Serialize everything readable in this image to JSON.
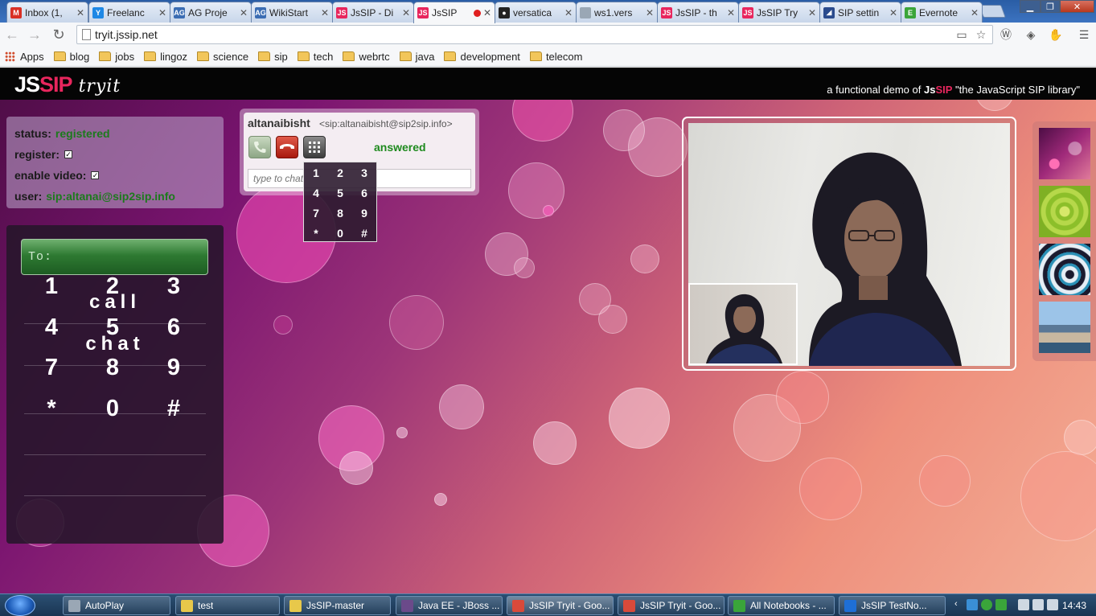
{
  "browser": {
    "tabs": [
      {
        "label": "Inbox (1,",
        "icon": "gmail-icon",
        "color": "#d93025",
        "glyph": "M"
      },
      {
        "label": "Freelanc",
        "icon": "freelancer-icon",
        "color": "#1e88e5",
        "glyph": "Y"
      },
      {
        "label": "AG Proje",
        "icon": "ag-icon",
        "color": "#3b6db3",
        "glyph": "AG"
      },
      {
        "label": "WikiStart",
        "icon": "ag-icon",
        "color": "#3b6db3",
        "glyph": "AG"
      },
      {
        "label": "JsSIP - Di",
        "icon": "jssip-icon",
        "color": "#e8265d",
        "glyph": "JS"
      },
      {
        "label": "JsSIP",
        "icon": "jssip-icon",
        "color": "#e8265d",
        "glyph": "JS",
        "active": true
      },
      {
        "label": "versatica",
        "icon": "github-icon",
        "color": "#222222",
        "glyph": "●"
      },
      {
        "label": "ws1.vers",
        "icon": "page-icon",
        "color": "#9aa7b5",
        "glyph": ""
      },
      {
        "label": "JsSIP - th",
        "icon": "jssip-icon",
        "color": "#e8265d",
        "glyph": "JS"
      },
      {
        "label": "JsSIP Try",
        "icon": "jssip-icon",
        "color": "#e8265d",
        "glyph": "JS"
      },
      {
        "label": "SIP settin",
        "icon": "sip-icon",
        "color": "#2a4b8d",
        "glyph": "◢"
      },
      {
        "label": "Evernote",
        "icon": "evernote-icon",
        "color": "#3aa53a",
        "glyph": "E"
      }
    ],
    "url": "tryit.jssip.net",
    "bookmarks": {
      "apps": "Apps",
      "folders": [
        "blog",
        "jobs",
        "lingoz",
        "science",
        "sip",
        "tech",
        "webrtc",
        "java",
        "development",
        "telecom"
      ]
    }
  },
  "header": {
    "logo_js": "JS",
    "logo_sip": "SIP",
    "logo_tryit": "tryit",
    "tagline_pre": "a functional demo of",
    "tagline_js": "Js",
    "tagline_sip": "SIP",
    "tagline_post": "\"the JavaScript SIP library\""
  },
  "status": {
    "status_label": "status:",
    "status_value": "registered",
    "register_label": "register:",
    "register_checked": true,
    "video_label": "enable video:",
    "video_checked": true,
    "user_label": "user:",
    "user_value": "sip:altanai@sip2sip.info"
  },
  "dialer": {
    "to_label": "To:",
    "call_label": "call",
    "chat_label": "chat",
    "keys": [
      "1",
      "2",
      "3",
      "4",
      "5",
      "6",
      "7",
      "8",
      "9",
      "*",
      "0",
      "#"
    ]
  },
  "session": {
    "peer_name": "altanaibisht",
    "peer_uri": "<sip:altanaibisht@sip2sip.info>",
    "state": "answered",
    "chat_placeholder": "type to chat",
    "dtmf_keys": [
      "1",
      "2",
      "3",
      "4",
      "5",
      "6",
      "7",
      "8",
      "9",
      "*",
      "0",
      "#"
    ]
  },
  "taskbar": {
    "tasks": [
      {
        "label": "AutoPlay",
        "color": "#9aa7b5"
      },
      {
        "label": "test",
        "color": "#e8c84a"
      },
      {
        "label": "JsSIP-master",
        "color": "#e8c84a"
      },
      {
        "label": "Java EE - JBoss ...",
        "color": "#6b4a8a"
      },
      {
        "label": "JsSIP Tryit - Goo...",
        "color": "#d94a3a",
        "active": true
      },
      {
        "label": "JsSIP Tryit - Goo...",
        "color": "#d94a3a"
      },
      {
        "label": "All Notebooks - ...",
        "color": "#3aa53a"
      },
      {
        "label": "JsSIP TestNo...",
        "color": "#1e6fd6"
      }
    ],
    "clock": "14:43"
  }
}
